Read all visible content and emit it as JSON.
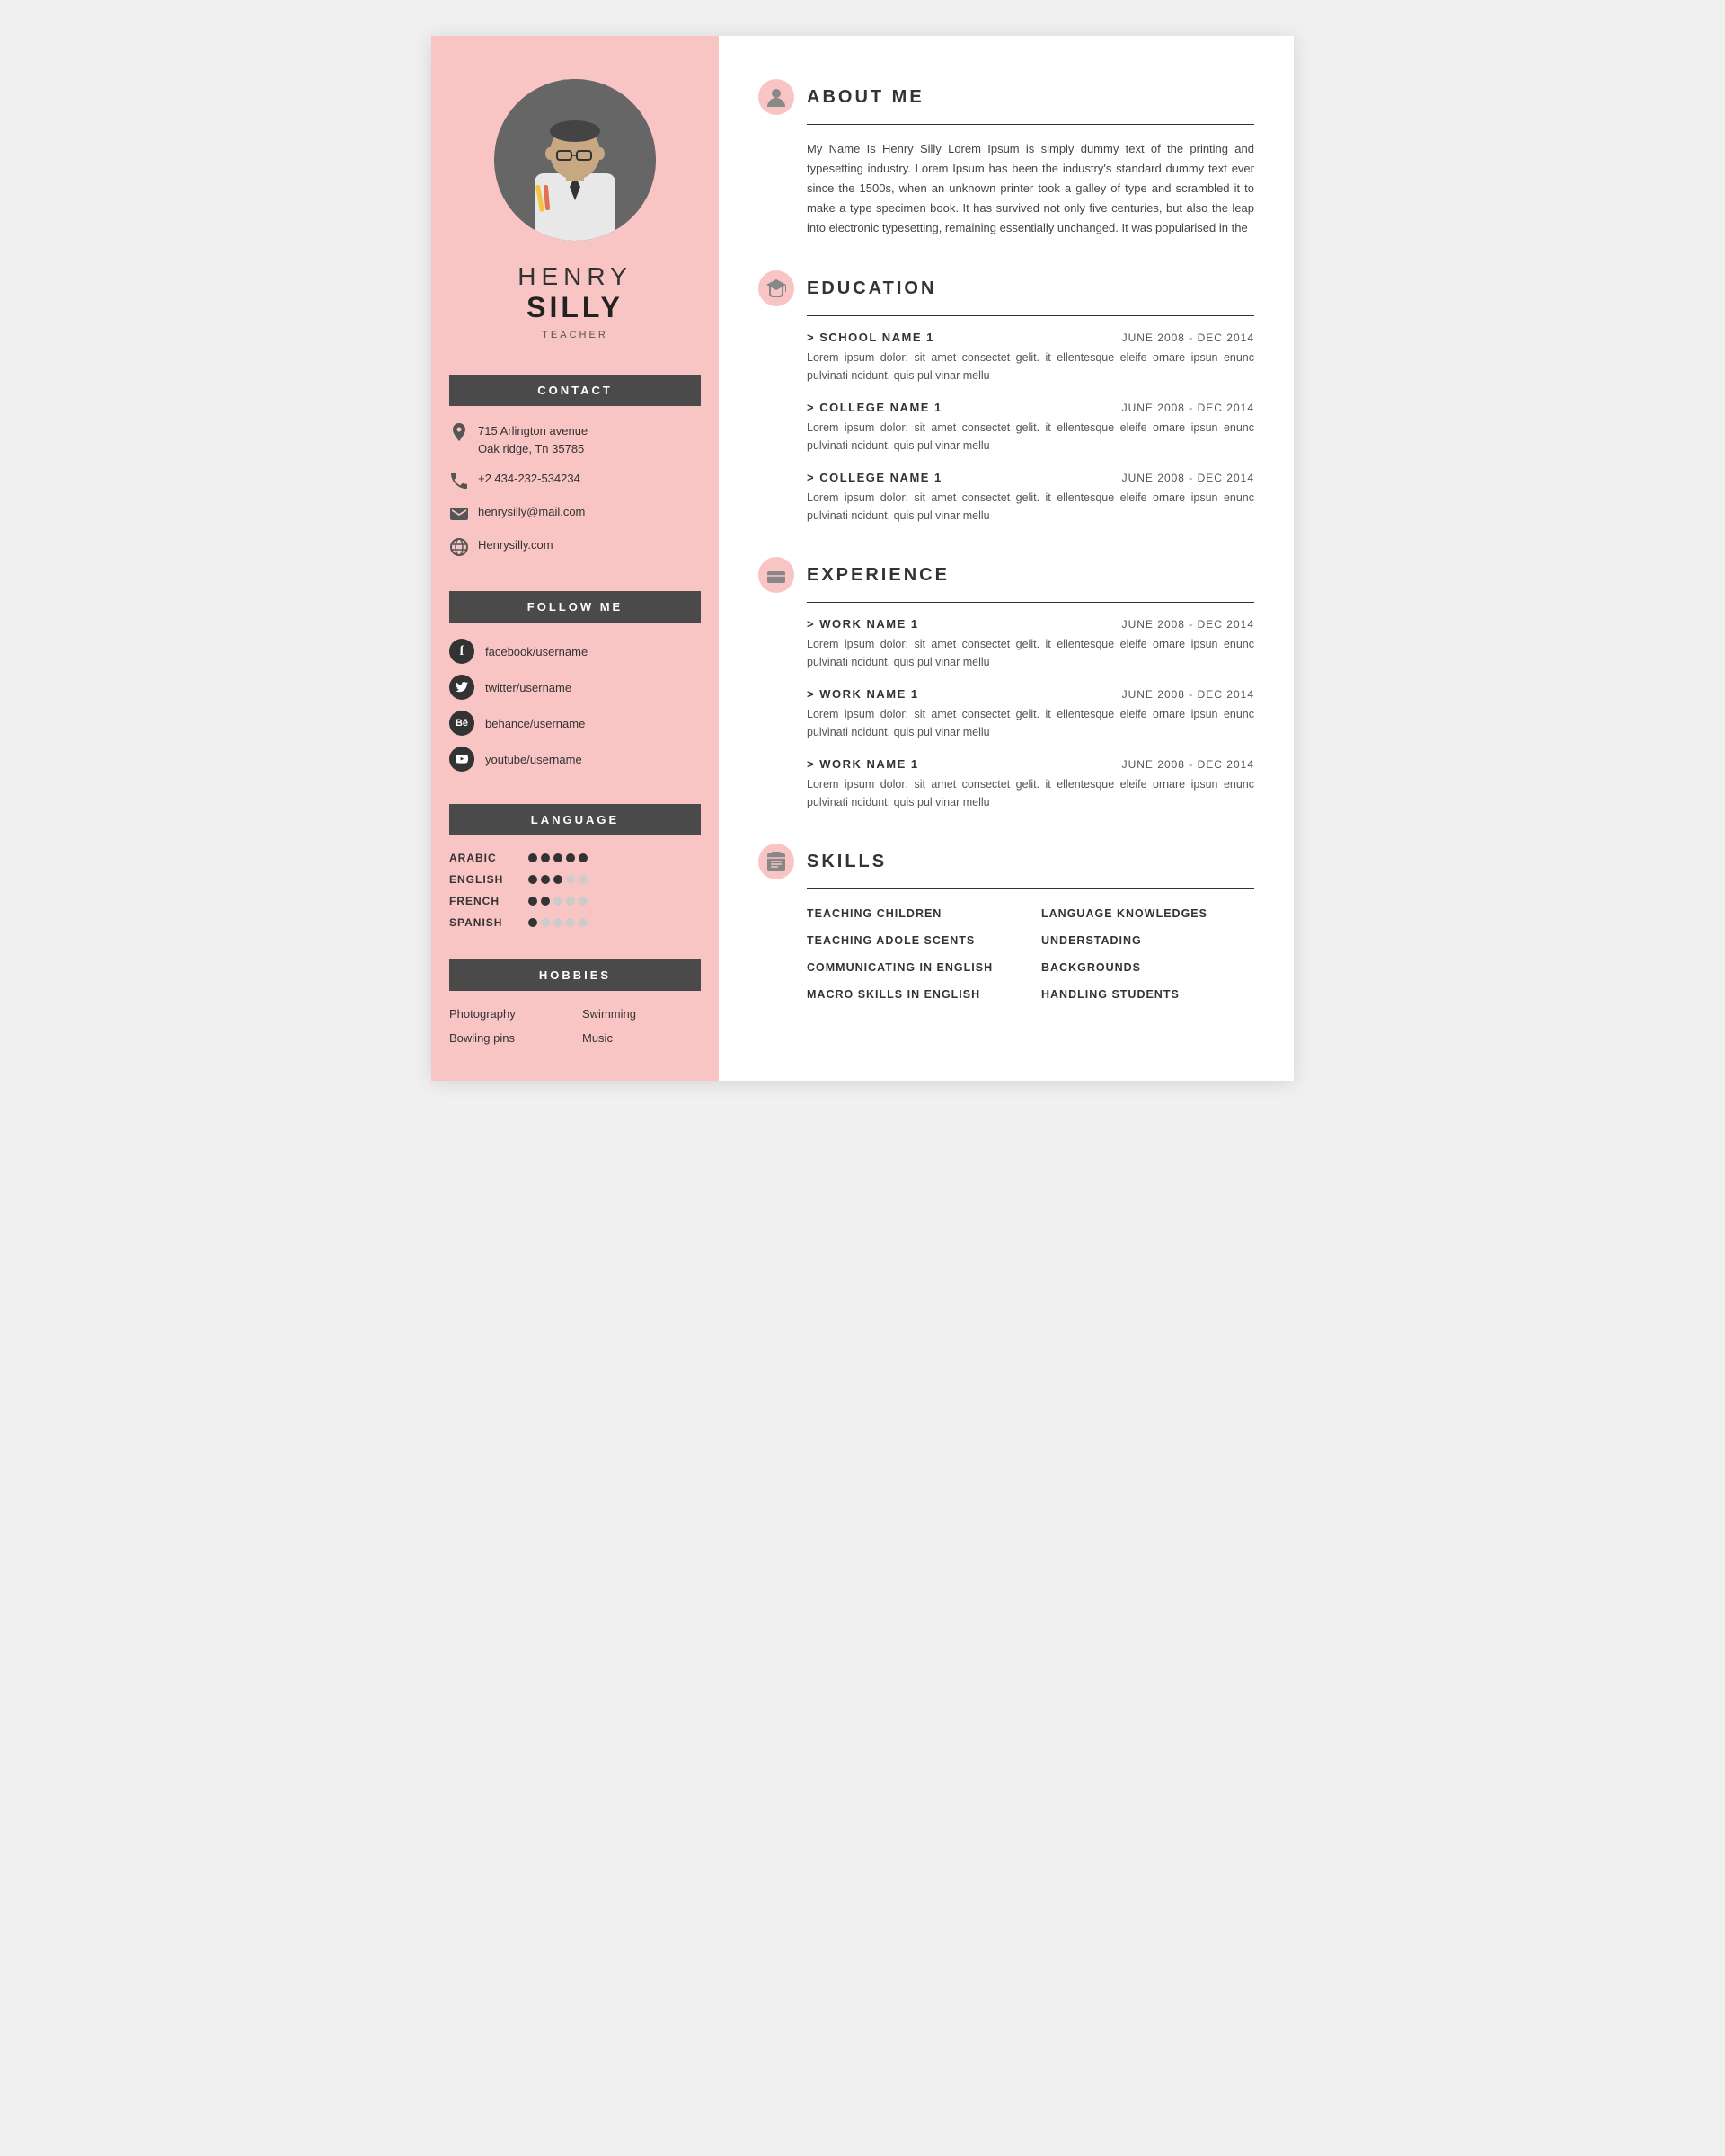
{
  "sidebar": {
    "name_first": "HENRY",
    "name_last": "SILLY",
    "job_title": "TEACHER",
    "contact_header": "CONTACT",
    "contact": [
      {
        "icon": "location",
        "line1": "715 Arlington avenue",
        "line2": "Oak ridge, Tn 35785"
      },
      {
        "icon": "phone",
        "line1": "+2 434-232-534234"
      },
      {
        "icon": "email",
        "line1": "henrysilly@mail.com"
      },
      {
        "icon": "web",
        "line1": "Henrysilly.com"
      }
    ],
    "follow_header": "FOLLOW ME",
    "social": [
      {
        "icon": "f",
        "text": "facebook/username"
      },
      {
        "icon": "t",
        "text": "twitter/username"
      },
      {
        "icon": "b",
        "text": "behance/username"
      },
      {
        "icon": "y",
        "text": "youtube/username"
      }
    ],
    "language_header": "LANGUAGE",
    "languages": [
      {
        "name": "ARABIC",
        "filled": 5,
        "empty": 0
      },
      {
        "name": "ENGLISH",
        "filled": 3,
        "empty": 2
      },
      {
        "name": "FRENCH",
        "filled": 2,
        "empty": 3
      },
      {
        "name": "SPANISH",
        "filled": 1,
        "empty": 4
      }
    ],
    "hobbies_header": "HOBBIES",
    "hobbies": [
      "Photography",
      "Swimming",
      "Bowling pins",
      "Music"
    ]
  },
  "main": {
    "about_title": "ABOUT ME",
    "about_text": "My Name Is Henry Silly Lorem Ipsum is simply dummy text of the printing and typesetting industry. Lorem Ipsum has been the industry's standard dummy text ever since the 1500s, when an unknown printer took a galley of type and scrambled it to make a type specimen book. It has survived not only five centuries, but also the leap into electronic typesetting, remaining essentially unchanged. It was popularised in the",
    "education_title": "EDUCATION",
    "education_entries": [
      {
        "title": "SCHOOL NAME 1",
        "date": "JUNE 2008 - DEC 2014",
        "desc": "Lorem ipsum dolor: sit amet consectet gelit. it ellentesque eleife ornare ipsun enunc pulvinati ncidunt. quis pul vinar mellu"
      },
      {
        "title": "COLLEGE NAME 1",
        "date": "JUNE 2008 - DEC 2014",
        "desc": "Lorem ipsum dolor: sit amet consectet gelit. it ellentesque eleife ornare ipsun enunc pulvinati ncidunt. quis pul vinar mellu"
      },
      {
        "title": "COLLEGE NAME 1",
        "date": "JUNE 2008 - DEC 2014",
        "desc": "Lorem ipsum dolor: sit amet consectet gelit. it ellentesque eleife ornare ipsun enunc pulvinati ncidunt. quis pul vinar mellu"
      }
    ],
    "experience_title": "EXPERIENCE",
    "experience_entries": [
      {
        "title": "WORK NAME 1",
        "date": "JUNE 2008 - DEC 2014",
        "desc": "Lorem ipsum dolor: sit amet consectet gelit. it ellentesque eleife ornare ipsun enunc pulvinati ncidunt. quis pul vinar mellu"
      },
      {
        "title": "WORK NAME 1",
        "date": "JUNE 2008 - DEC 2014",
        "desc": "Lorem ipsum dolor: sit amet consectet gelit. it ellentesque eleife ornare ipsun enunc pulvinati ncidunt. quis pul vinar mellu"
      },
      {
        "title": "WORK NAME 1",
        "date": "JUNE 2008 - DEC 2014",
        "desc": "Lorem ipsum dolor: sit amet consectet gelit. it ellentesque eleife ornare ipsun enunc pulvinati ncidunt. quis pul vinar mellu"
      }
    ],
    "skills_title": "SKILLS",
    "skills": [
      "TEACHING CHILDREN",
      "LANGUAGE KNOWLEDGES",
      "TEACHING ADOLE SCENTS",
      "UNDERSTADING",
      "COMMUNICATING IN ENGLISH",
      "BACKGROUNDS",
      "MACRO SKILLS IN ENGLISH",
      "HANDLING STUDENTS"
    ]
  }
}
